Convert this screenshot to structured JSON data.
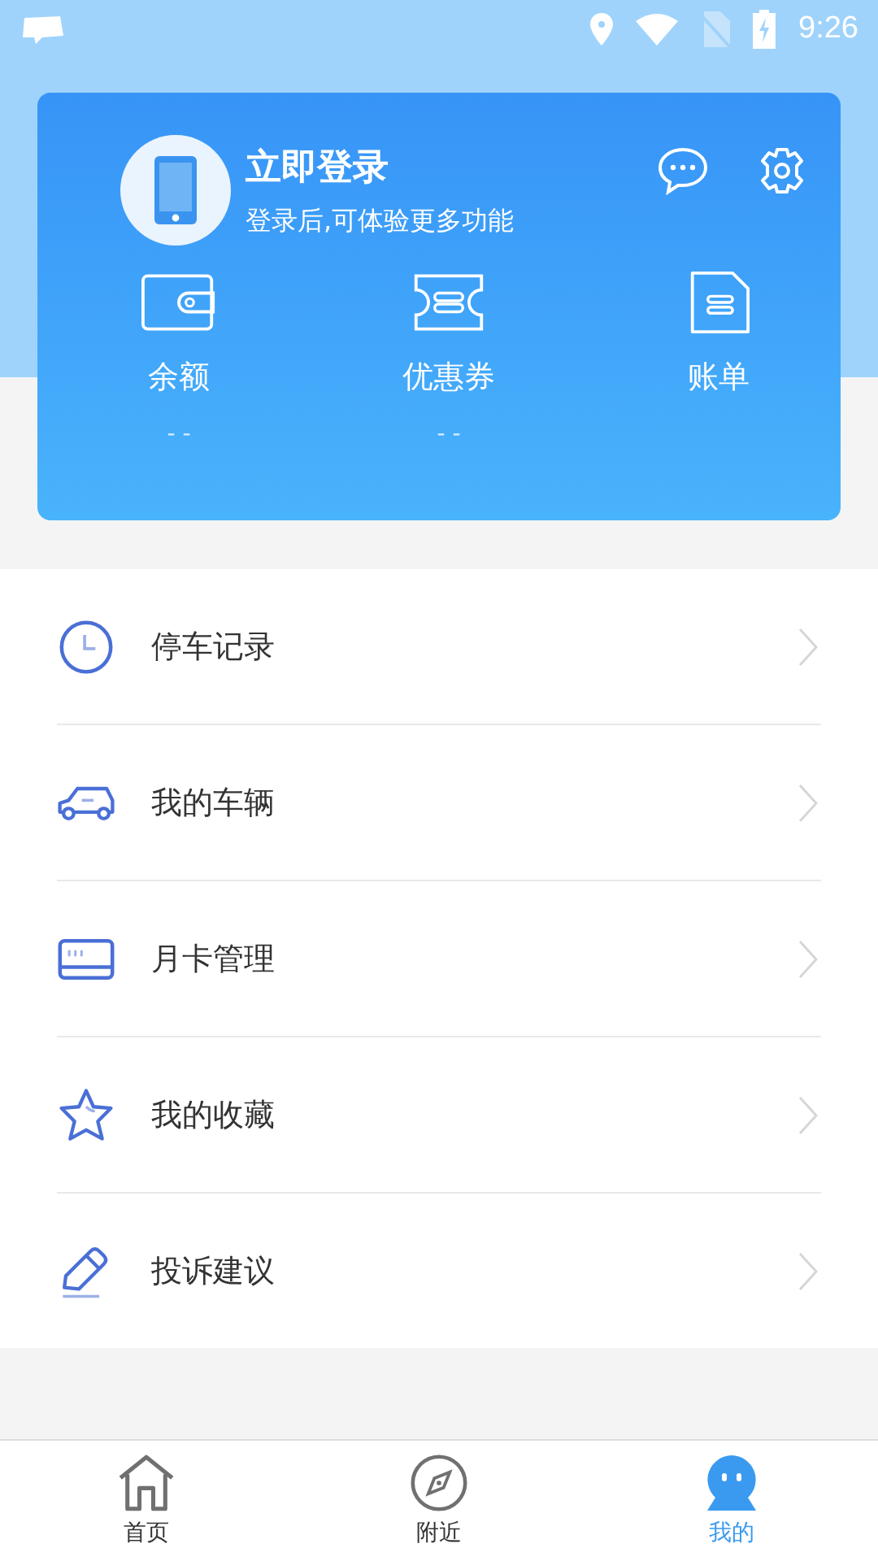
{
  "status_bar": {
    "time": "9:26"
  },
  "profile": {
    "title": "立即登录",
    "subtitle": "登录后,可体验更多功能"
  },
  "stats": [
    {
      "kind": "wallet",
      "label": "余额",
      "value": "- -"
    },
    {
      "kind": "ticket",
      "label": "优惠券",
      "value": "- -"
    },
    {
      "kind": "bill",
      "label": "账单"
    }
  ],
  "menu": [
    {
      "kind": "clock",
      "label": "停车记录"
    },
    {
      "kind": "car",
      "label": "我的车辆"
    },
    {
      "kind": "card",
      "label": "月卡管理"
    },
    {
      "kind": "star",
      "label": "我的收藏"
    },
    {
      "kind": "pen",
      "label": "投诉建议"
    }
  ],
  "tabs": [
    {
      "kind": "home",
      "label": "首页",
      "selected": false
    },
    {
      "kind": "compass",
      "label": "附近",
      "selected": false
    },
    {
      "kind": "person",
      "label": "我的",
      "selected": true
    }
  ]
}
